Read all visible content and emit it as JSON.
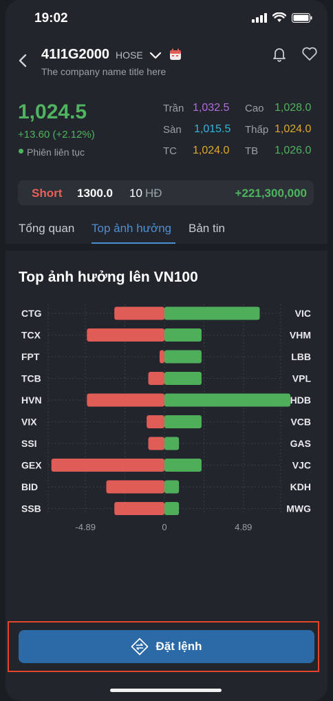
{
  "status_bar": {
    "time": "19:02"
  },
  "header": {
    "symbol": "41I1G2000",
    "exchange": "HOSE",
    "company_name": "The company name title here"
  },
  "price": {
    "last": "1,024.5",
    "change": "+13.60 (+2.12%)",
    "session": "Phiên liên tục"
  },
  "stats": [
    {
      "label": "Trần",
      "value": "1,032.5",
      "color": "#b36be0"
    },
    {
      "label": "Cao",
      "value": "1,028.0",
      "color": "#4fb35f"
    },
    {
      "label": "Sàn",
      "value": "1,015.5",
      "color": "#35b6d6"
    },
    {
      "label": "Thấp",
      "value": "1,024.0",
      "color": "#e0a72e"
    },
    {
      "label": "TC",
      "value": "1,024.0",
      "color": "#e0a72e"
    },
    {
      "label": "TB",
      "value": "1,026.0",
      "color": "#4fb35f"
    }
  ],
  "position": {
    "side": "Short",
    "price": "1300.0",
    "qty": "10",
    "unit": "HĐ",
    "amount": "+221,300,000"
  },
  "tabs": [
    {
      "label": "Tổng quan",
      "active": false
    },
    {
      "label": "Top ảnh hưởng",
      "active": true
    },
    {
      "label": "Bản tin",
      "active": false
    }
  ],
  "section": {
    "title": "Top ảnh hưởng lên VN100"
  },
  "chart_data": {
    "type": "bar",
    "orientation": "horizontal-diverging",
    "xlim": [
      -7.2,
      7.2
    ],
    "x_ticks": [
      "-4.89",
      "0",
      "4.89"
    ],
    "grid": true,
    "negative_color": "#e05c57",
    "positive_color": "#4fae5a",
    "rows": [
      {
        "left": "CTG",
        "left_value": -3.1,
        "right": "VIC",
        "right_value": 5.9
      },
      {
        "left": "TCX",
        "left_value": -4.8,
        "right": "VHM",
        "right_value": 2.3
      },
      {
        "left": "FPT",
        "left_value": -0.3,
        "right": "LBB",
        "right_value": 2.3
      },
      {
        "left": "TCB",
        "left_value": -1.0,
        "right": "VPL",
        "right_value": 2.3
      },
      {
        "left": "HVN",
        "left_value": -4.8,
        "right": "HDB",
        "right_value": 7.8
      },
      {
        "left": "VIX",
        "left_value": -1.1,
        "right": "VCB",
        "right_value": 2.3
      },
      {
        "left": "SSI",
        "left_value": -1.0,
        "right": "GAS",
        "right_value": 0.9
      },
      {
        "left": "GEX",
        "left_value": -7.0,
        "right": "VJC",
        "right_value": 2.3
      },
      {
        "left": "BID",
        "left_value": -3.6,
        "right": "KDH",
        "right_value": 0.9
      },
      {
        "left": "SSB",
        "left_value": -3.1,
        "right": "MWG",
        "right_value": 0.9
      }
    ]
  },
  "order_button": {
    "label": "Đặt lệnh"
  }
}
